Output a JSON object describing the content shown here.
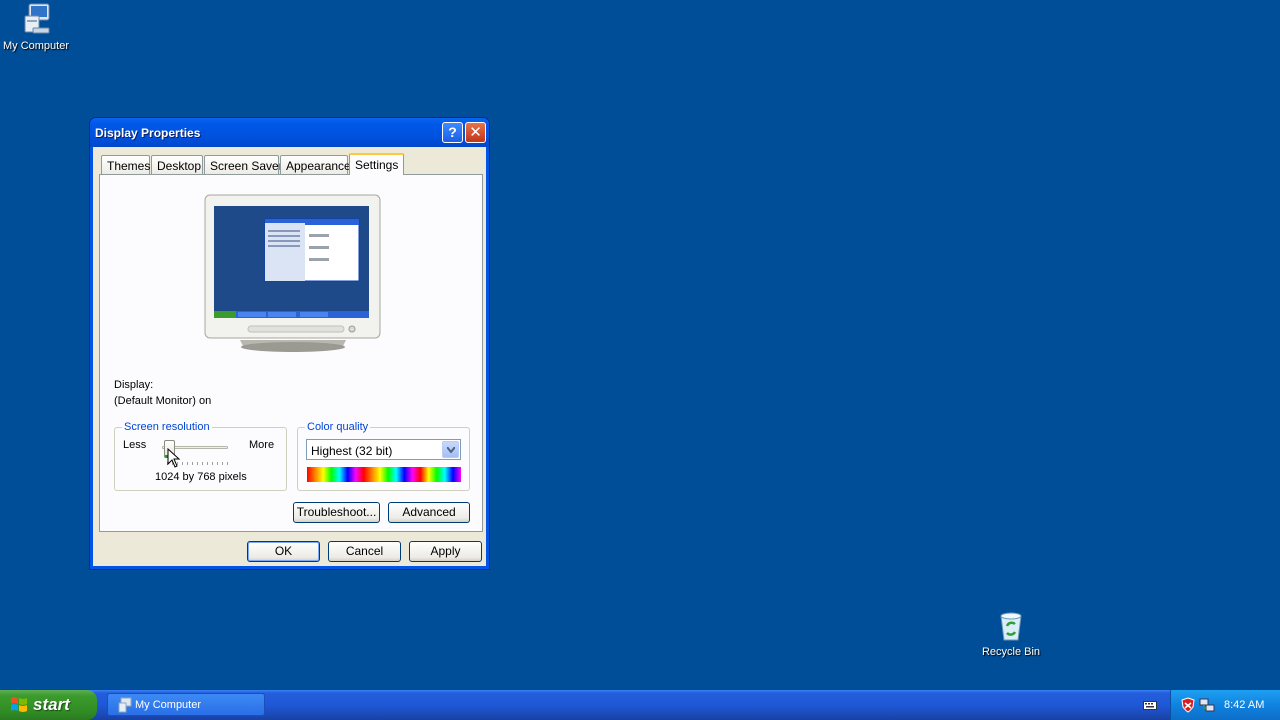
{
  "desktop": {
    "icons": [
      {
        "label": "My Computer",
        "icon": "my-computer-icon"
      },
      {
        "label": "Recycle Bin",
        "icon": "recycle-bin-icon"
      }
    ],
    "background_color": "#004e98"
  },
  "window": {
    "title": "Display Properties",
    "help_label": "?",
    "close_label": "✕",
    "tabs": [
      {
        "label": "Themes"
      },
      {
        "label": "Desktop"
      },
      {
        "label": "Screen Saver"
      },
      {
        "label": "Appearance"
      },
      {
        "label": "Settings",
        "active": true
      }
    ],
    "display_label": "Display:",
    "display_value": "(Default Monitor) on",
    "screen_resolution": {
      "title": "Screen resolution",
      "less_label": "Less",
      "more_label": "More",
      "value_text": "1024 by 768 pixels",
      "slider_fraction": 0.12
    },
    "color_quality": {
      "title": "Color quality",
      "selected": "Highest (32 bit)"
    },
    "troubleshoot_label": "Troubleshoot...",
    "advanced_label": "Advanced",
    "ok_label": "OK",
    "cancel_label": "Cancel",
    "apply_label": "Apply"
  },
  "taskbar": {
    "start_label": "start",
    "tasks": [
      {
        "label": "My Computer",
        "icon": "my-computer-icon"
      }
    ],
    "clock": "8:42 AM",
    "tray_icons": [
      "keyboard-icon",
      "security-shield-icon",
      "network-icon"
    ]
  }
}
